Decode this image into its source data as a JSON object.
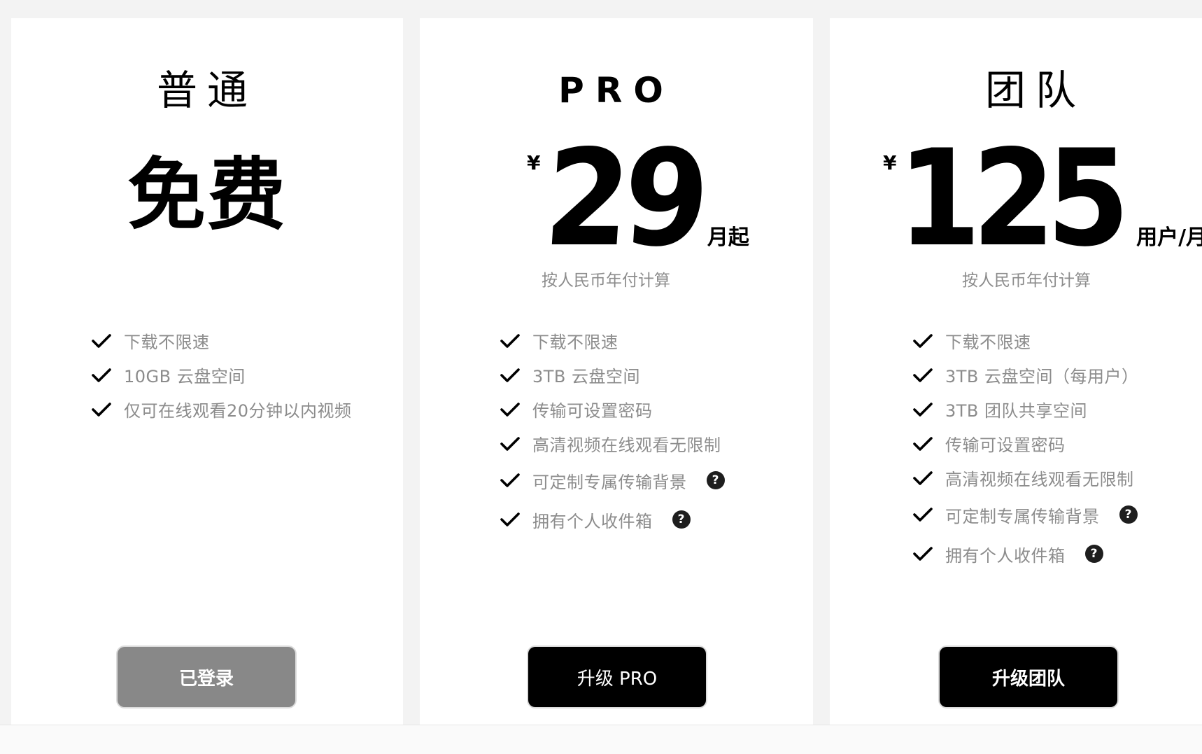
{
  "plans": [
    {
      "name": "普通",
      "price_text": "免费",
      "features": [
        {
          "label": "下载不限速",
          "has_help": false
        },
        {
          "label": "10GB 云盘空间",
          "has_help": false
        },
        {
          "label": "仅可在线观看20分钟以内视频",
          "has_help": false
        }
      ],
      "button_label": "已登录",
      "button_state": "disabled",
      "button_color": "#888888"
    },
    {
      "name": "PRO",
      "currency": "¥",
      "amount": "29",
      "period": "月起",
      "price_note": "按人民币年付计算",
      "features": [
        {
          "label": "下载不限速",
          "has_help": false
        },
        {
          "label": "3TB 云盘空间",
          "has_help": false
        },
        {
          "label": "传输可设置密码",
          "has_help": false
        },
        {
          "label": "高清视频在线观看无限制",
          "has_help": false
        },
        {
          "label": "可定制专属传输背景",
          "has_help": true
        },
        {
          "label": "拥有个人收件箱",
          "has_help": true
        }
      ],
      "button_label": "升级 PRO",
      "button_color": "#000000"
    },
    {
      "name": "团队",
      "currency": "¥",
      "amount": "125",
      "period": "用户/月起",
      "price_note": "按人民币年付计算",
      "features": [
        {
          "label": "下载不限速",
          "has_help": false
        },
        {
          "label": "3TB 云盘空间（每用户）",
          "has_help": false
        },
        {
          "label": "3TB 团队共享空间",
          "has_help": false
        },
        {
          "label": "传输可设置密码",
          "has_help": false
        },
        {
          "label": "高清视频在线观看无限制",
          "has_help": false
        },
        {
          "label": "可定制专属传输背景",
          "has_help": true
        },
        {
          "label": "拥有个人收件箱",
          "has_help": true
        }
      ],
      "button_label": "升级团队",
      "button_color": "#000000"
    }
  ],
  "help_icon_glyph": "?",
  "icons": {
    "check": "check-icon",
    "help": "help-circle-icon"
  },
  "colors": {
    "page_background": "#f3f3f3",
    "card_background": "#ffffff",
    "feature_text": "#8c8c8c",
    "primary_button": "#000000",
    "disabled_button": "#888888"
  }
}
